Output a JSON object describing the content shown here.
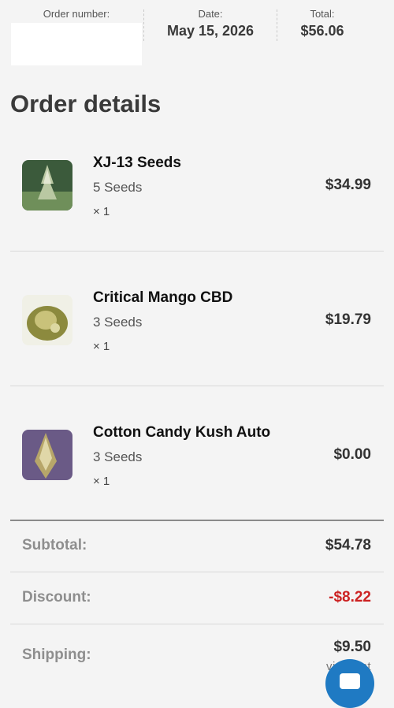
{
  "summary": {
    "order_number_label": "Order number:",
    "date_label": "Date:",
    "date_value": "May 15, 2026",
    "total_label": "Total:",
    "total_value": "$56.06"
  },
  "title": "Order details",
  "items": [
    {
      "name": "XJ-13 Seeds",
      "variant": "5 Seeds",
      "qty": "× 1",
      "price": "$34.99",
      "thumb_colors": [
        "#2f4a2f",
        "#6f8f5a"
      ]
    },
    {
      "name": "Critical Mango CBD",
      "variant": "3 Seeds",
      "qty": "× 1",
      "price": "$19.79",
      "thumb_colors": [
        "#7a7a34",
        "#c9c27a"
      ]
    },
    {
      "name": "Cotton Candy Kush Auto",
      "variant": "3 Seeds",
      "qty": "× 1",
      "price": "$0.00",
      "thumb_colors": [
        "#6a5a86",
        "#b7a66a"
      ]
    }
  ],
  "totals": {
    "subtotal_label": "Subtotal:",
    "subtotal_value": "$54.78",
    "discount_label": "Discount:",
    "discount_value": "-$8.22",
    "shipping_label": "Shipping:",
    "shipping_value": "$9.50",
    "shipping_via": "via First"
  },
  "colors": {
    "accent": "#1f7ac3",
    "discount": "#cc2222"
  },
  "icons": {
    "chat": "chat-icon"
  }
}
